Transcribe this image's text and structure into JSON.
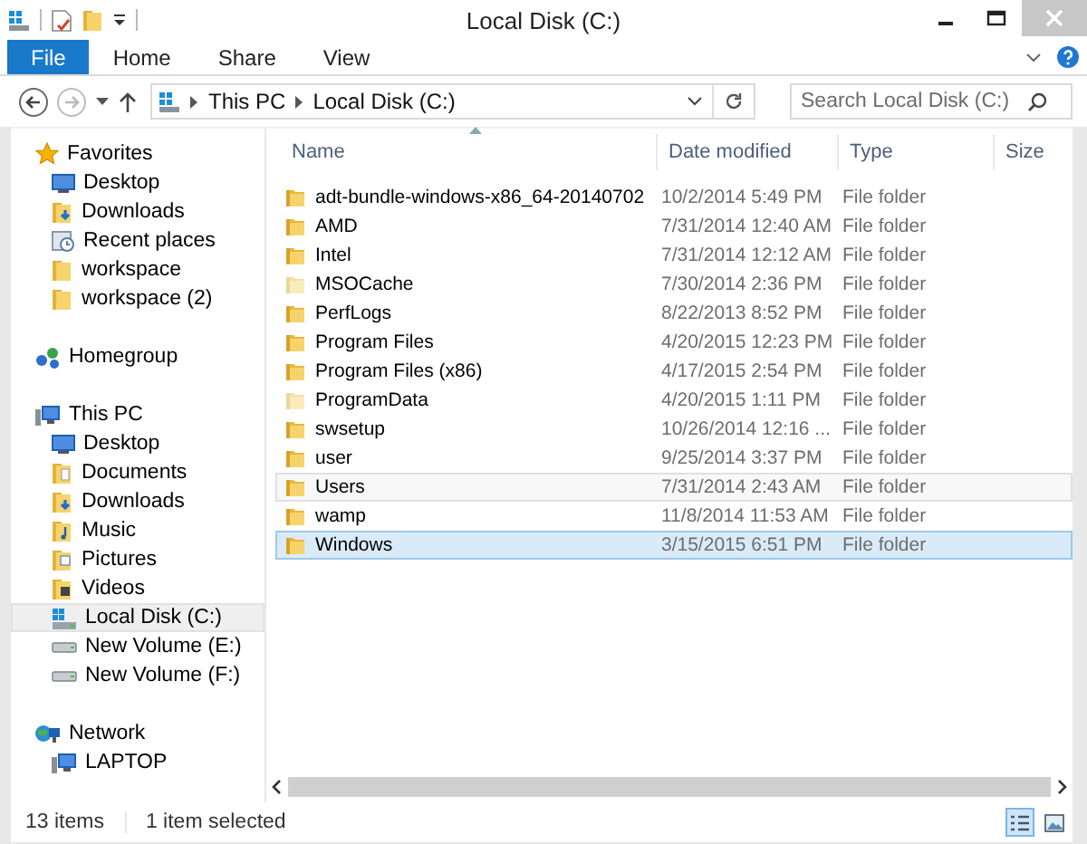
{
  "window": {
    "title": "Local Disk (C:)"
  },
  "ribbon": {
    "tabs": [
      {
        "label": "File",
        "kind": "file"
      },
      {
        "label": "Home",
        "kind": "tab"
      },
      {
        "label": "Share",
        "kind": "tab"
      },
      {
        "label": "View",
        "kind": "tab"
      }
    ]
  },
  "address": {
    "path": [
      "This PC",
      "Local Disk (C:)"
    ]
  },
  "search": {
    "placeholder": "Search Local Disk (C:)"
  },
  "navigation": [
    {
      "label": "Favorites",
      "kind": "star",
      "selected": false,
      "children": [
        {
          "label": "Desktop",
          "kind": "desktop",
          "selected": false
        },
        {
          "label": "Downloads",
          "kind": "downloads",
          "selected": false
        },
        {
          "label": "Recent places",
          "kind": "recent",
          "selected": false
        },
        {
          "label": "workspace",
          "kind": "folder",
          "selected": false
        },
        {
          "label": "workspace (2)",
          "kind": "folder",
          "selected": false
        }
      ]
    },
    {
      "label": "Homegroup",
      "kind": "homegroup",
      "selected": false
    },
    {
      "label": "This PC",
      "kind": "pc",
      "selected": false,
      "children": [
        {
          "label": "Desktop",
          "kind": "desktop",
          "selected": false
        },
        {
          "label": "Documents",
          "kind": "documents",
          "selected": false
        },
        {
          "label": "Downloads",
          "kind": "downloads",
          "selected": false
        },
        {
          "label": "Music",
          "kind": "music",
          "selected": false
        },
        {
          "label": "Pictures",
          "kind": "pictures",
          "selected": false
        },
        {
          "label": "Videos",
          "kind": "videos",
          "selected": false
        },
        {
          "label": "Local Disk (C:)",
          "kind": "disk",
          "selected": true
        },
        {
          "label": "New Volume (E:)",
          "kind": "drive",
          "selected": false
        },
        {
          "label": "New Volume (F:)",
          "kind": "drive",
          "selected": false
        }
      ]
    },
    {
      "label": "Network",
      "kind": "network",
      "selected": false,
      "children": [
        {
          "label": "LAPTOP",
          "kind": "pc",
          "selected": false
        }
      ]
    }
  ],
  "columns": [
    {
      "label": "Name",
      "sorted": true
    },
    {
      "label": "Date modified",
      "sorted": false
    },
    {
      "label": "Type",
      "sorted": false
    },
    {
      "label": "Size",
      "sorted": false
    }
  ],
  "rows": [
    {
      "name": "adt-bundle-windows-x86_64-20140702",
      "date": "10/2/2014 5:49 PM",
      "type": "File folder",
      "hidden": false,
      "hovered": false,
      "selected": false
    },
    {
      "name": "AMD",
      "date": "7/31/2014 12:40 AM",
      "type": "File folder",
      "hidden": false,
      "hovered": false,
      "selected": false
    },
    {
      "name": "Intel",
      "date": "7/31/2014 12:12 AM",
      "type": "File folder",
      "hidden": false,
      "hovered": false,
      "selected": false
    },
    {
      "name": "MSOCache",
      "date": "7/30/2014 2:36 PM",
      "type": "File folder",
      "hidden": true,
      "hovered": false,
      "selected": false
    },
    {
      "name": "PerfLogs",
      "date": "8/22/2013 8:52 PM",
      "type": "File folder",
      "hidden": false,
      "hovered": false,
      "selected": false
    },
    {
      "name": "Program Files",
      "date": "4/20/2015 12:23 PM",
      "type": "File folder",
      "hidden": false,
      "hovered": false,
      "selected": false
    },
    {
      "name": "Program Files (x86)",
      "date": "4/17/2015 2:54 PM",
      "type": "File folder",
      "hidden": false,
      "hovered": false,
      "selected": false
    },
    {
      "name": "ProgramData",
      "date": "4/20/2015 1:11 PM",
      "type": "File folder",
      "hidden": true,
      "hovered": false,
      "selected": false
    },
    {
      "name": "swsetup",
      "date": "10/26/2014 12:16 ...",
      "type": "File folder",
      "hidden": false,
      "hovered": false,
      "selected": false
    },
    {
      "name": "user",
      "date": "9/25/2014 3:37 PM",
      "type": "File folder",
      "hidden": false,
      "hovered": false,
      "selected": false
    },
    {
      "name": "Users",
      "date": "7/31/2014 2:43 AM",
      "type": "File folder",
      "hidden": false,
      "hovered": true,
      "selected": false
    },
    {
      "name": "wamp",
      "date": "11/8/2014 11:53 AM",
      "type": "File folder",
      "hidden": false,
      "hovered": false,
      "selected": false
    },
    {
      "name": "Windows",
      "date": "3/15/2015 6:51 PM",
      "type": "File folder",
      "hidden": false,
      "hovered": false,
      "selected": true
    }
  ],
  "status_bar": {
    "count": "13 items",
    "selection": "1 item selected",
    "views": [
      {
        "kind": "details",
        "selected": true
      },
      {
        "kind": "large-icons",
        "selected": false
      }
    ]
  }
}
